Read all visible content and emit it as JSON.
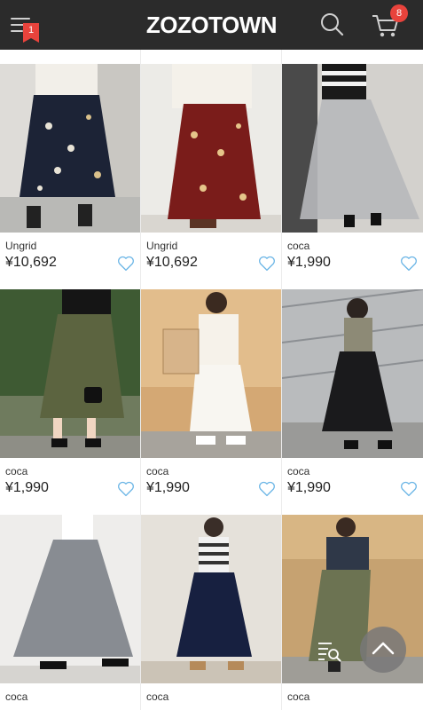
{
  "header": {
    "logo": "ZOZOTOWN",
    "menu_badge": "1",
    "cart_count": "8"
  },
  "colors": {
    "header_bg": "#2b2b2b",
    "badge": "#e8433c",
    "heart_outline": "#6cb6e6"
  },
  "products": [
    {
      "brand": "Ungrid",
      "price": "¥10,692",
      "photo": "navy floral pleated maxi skirt"
    },
    {
      "brand": "Ungrid",
      "price": "¥10,692",
      "photo": "burgundy floral pleated maxi skirt"
    },
    {
      "brand": "coca",
      "price": "¥1,990",
      "photo": "light gray tulle maxi skirt"
    },
    {
      "brand": "coca",
      "price": "¥1,990",
      "photo": "olive green pleated skirt"
    },
    {
      "brand": "coca",
      "price": "¥1,990",
      "photo": "white tulle skirt with shopping bag"
    },
    {
      "brand": "coca",
      "price": "¥1,990",
      "photo": "black tulle skirt with gray top"
    },
    {
      "brand": "coca",
      "price": "",
      "photo": "gray tulle maxi skirt"
    },
    {
      "brand": "coca",
      "price": "",
      "photo": "navy tulle skirt with striped top"
    },
    {
      "brand": "coca",
      "price": "",
      "photo": "khaki wrap maxi skirt"
    }
  ],
  "icons": {
    "menu": "menu-icon",
    "search": "search-icon",
    "cart": "cart-icon",
    "favorite": "heart-icon",
    "filter": "filter-icon",
    "scroll_top": "chevron-up-icon"
  }
}
